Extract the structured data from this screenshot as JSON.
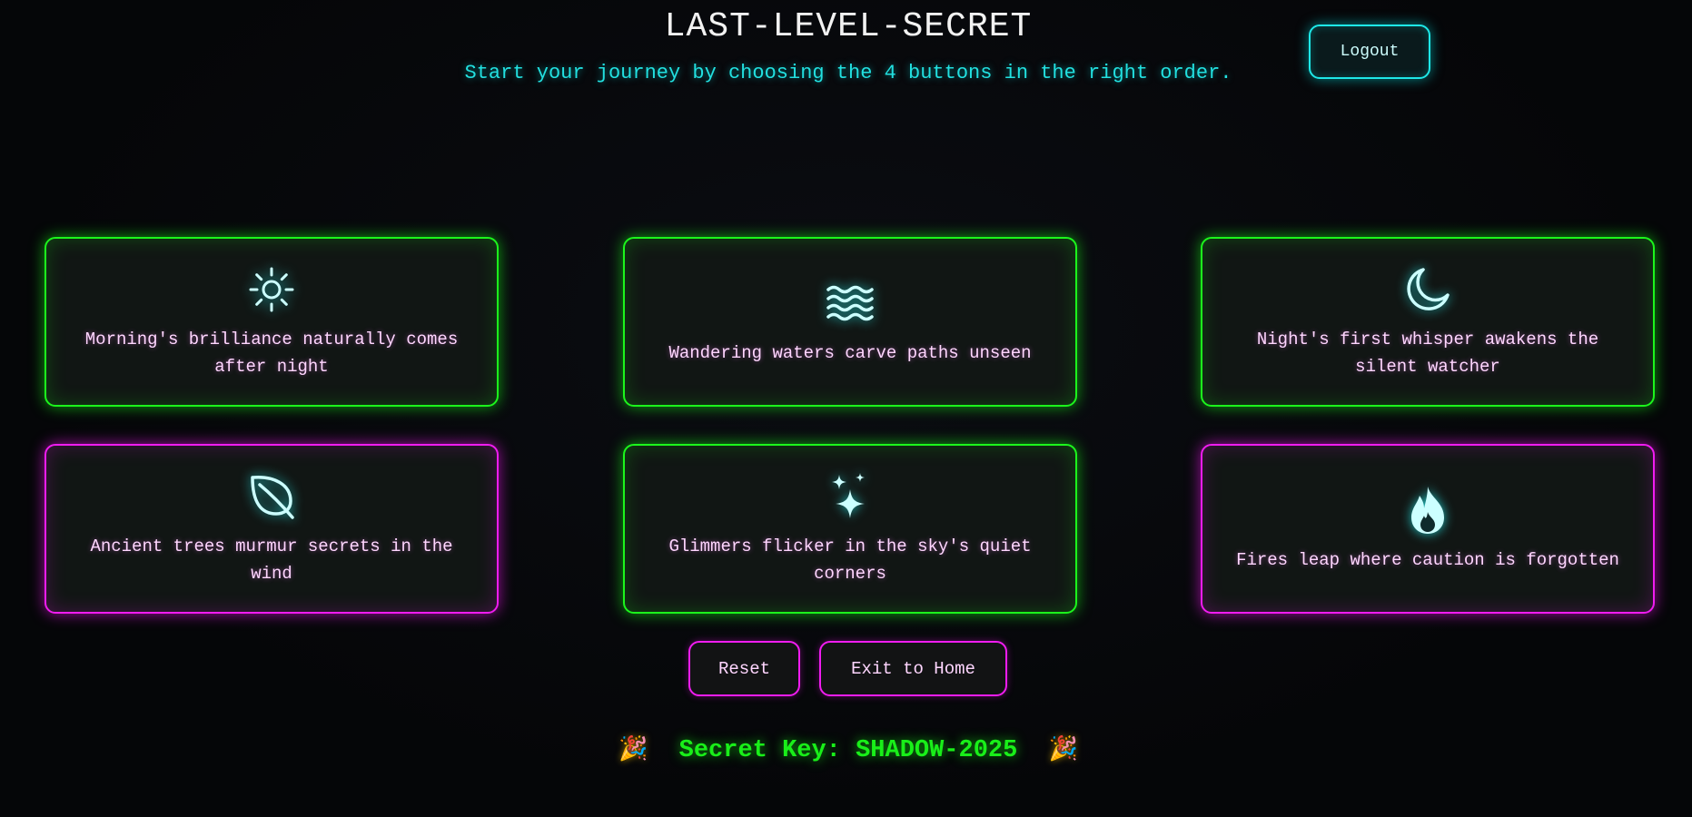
{
  "header": {
    "title": "LAST-LEVEL-SECRET",
    "subtitle": "Start your journey by choosing the 4 buttons in the right order.",
    "logout_label": "Logout"
  },
  "cards": [
    {
      "icon": "sun-icon",
      "text": "Morning's brilliance naturally comes after night",
      "state": "green"
    },
    {
      "icon": "waves-icon",
      "text": "Wandering waters carve paths unseen",
      "state": "green"
    },
    {
      "icon": "moon-icon",
      "text": "Night's first whisper awakens the silent watcher",
      "state": "green"
    },
    {
      "icon": "leaf-icon",
      "text": "Ancient trees murmur secrets in the wind",
      "state": "magenta"
    },
    {
      "icon": "sparkles-icon",
      "text": "Glimmers flicker in the sky's quiet corners",
      "state": "green"
    },
    {
      "icon": "flame-icon",
      "text": "Fires leap where caution is forgotten",
      "state": "magenta"
    }
  ],
  "actions": {
    "reset_label": "Reset",
    "exit_label": "Exit to Home"
  },
  "secret": {
    "emoji": "🎉",
    "label": "Secret Key: SHADOW-2025"
  },
  "colors": {
    "background": "#050608",
    "green_glow": "#1cf51c",
    "magenta_glow": "#f01cf0",
    "cyan_accent": "#22e0e0"
  }
}
